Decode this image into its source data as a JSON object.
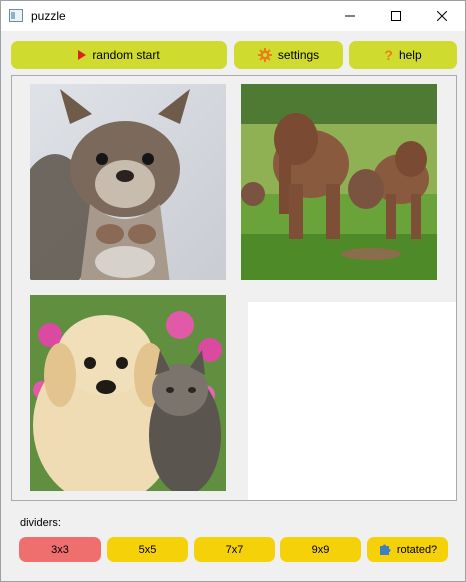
{
  "window": {
    "title": "puzzle"
  },
  "toolbar": {
    "random_start": "random start",
    "settings": "settings",
    "help": "help"
  },
  "puzzle": {
    "tiles": [
      {
        "content": "squirrel"
      },
      {
        "content": "elephants"
      },
      {
        "content": "puppy-and-kitten"
      }
    ],
    "empty_slot": true
  },
  "dividers": {
    "label": "dividers:",
    "options": [
      "3x3",
      "5x5",
      "7x7",
      "9x9"
    ],
    "selected": "3x3",
    "rotated_label": "rotated?"
  },
  "colors": {
    "toolbar_button": "#cfdb2e",
    "divider_button": "#f5d10a",
    "divider_selected": "#ef6f6f"
  }
}
